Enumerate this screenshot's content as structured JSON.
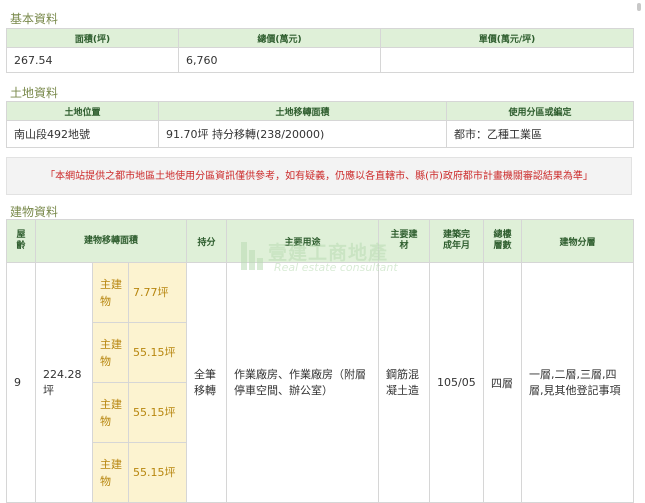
{
  "basic": {
    "title": "基本資料",
    "headers": [
      "面積(坪)",
      "總價(萬元)",
      "單價(萬元/坪)"
    ],
    "values": [
      "267.54",
      "6,760",
      ""
    ]
  },
  "land": {
    "title": "土地資料",
    "headers": [
      "土地位置",
      "土地移轉面積",
      "使用分區或編定"
    ],
    "values": [
      "南山段492地號",
      "91.70坪 持分移轉(238/20000)",
      "都市：乙種工業區"
    ]
  },
  "notice": "「本網站提供之都市地區土地使用分區資訊僅供參考，如有疑義，仍應以各直轄市、縣(市)政府都市計畫機關審認結果為準」",
  "building": {
    "title": "建物資料",
    "headers": {
      "floor_age": "屋齡",
      "transfer_area": "建物移轉面積",
      "share": "持分",
      "usage": "主要用途",
      "material": "主要建材",
      "completed": "建築完成年月",
      "total_floors": "總樓層數",
      "floor_division": "建物分層"
    },
    "row": {
      "floor_age": "9",
      "transfer_area": "224.28坪",
      "share": "全筆移轉",
      "usage": "作業廠房、作業廠房（附層停車空間、辦公室）",
      "material": "鋼筋混凝土造",
      "completed": "105/05",
      "total_floors": "四層",
      "floor_division": "一層,二層,三層,四層,見其他登記事項"
    },
    "sub_items": [
      {
        "type": "主建物",
        "area": "7.77坪"
      },
      {
        "type": "主建物",
        "area": "55.15坪"
      },
      {
        "type": "主建物",
        "area": "55.15坪"
      },
      {
        "type": "主建物",
        "area": "55.15坪"
      }
    ]
  },
  "watermark": {
    "cn": "壹建工商地產",
    "en": "Real estate consultant",
    "icon": "building-logo-icon"
  },
  "colors": {
    "header_bg": "#dff0d8",
    "section_title": "#7a8a4c",
    "notice_text": "#cc2b2b",
    "sub_item_bg": "#fcf3d0",
    "sub_item_text": "#b7860f"
  }
}
